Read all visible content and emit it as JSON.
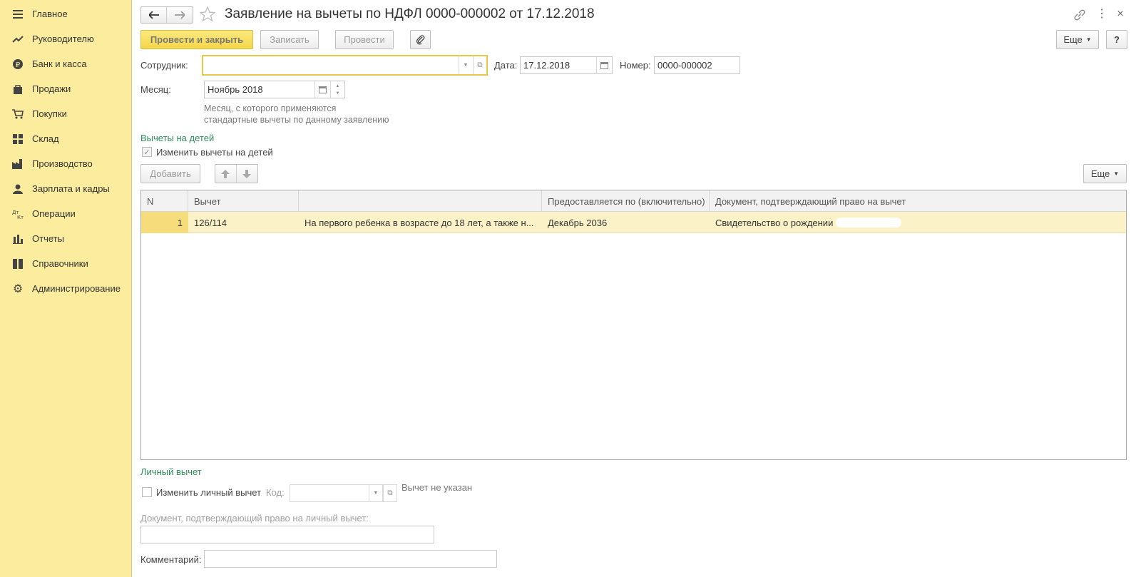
{
  "sidebar": {
    "items": [
      {
        "label": "Главное",
        "icon": "menu-icon"
      },
      {
        "label": "Руководителю",
        "icon": "trend-icon"
      },
      {
        "label": "Банк и касса",
        "icon": "ruble-icon"
      },
      {
        "label": "Продажи",
        "icon": "bag-icon"
      },
      {
        "label": "Покупки",
        "icon": "cart-icon"
      },
      {
        "label": "Склад",
        "icon": "warehouse-icon"
      },
      {
        "label": "Производство",
        "icon": "factory-icon"
      },
      {
        "label": "Зарплата и кадры",
        "icon": "person-icon"
      },
      {
        "label": "Операции",
        "icon": "dt-kt-icon"
      },
      {
        "label": "Отчеты",
        "icon": "bar-chart-icon"
      },
      {
        "label": "Справочники",
        "icon": "book-icon"
      },
      {
        "label": "Администрирование",
        "icon": "gear-icon"
      }
    ]
  },
  "header": {
    "title": "Заявление на вычеты по НДФЛ 0000-000002 от 17.12.2018"
  },
  "toolbar": {
    "post_close": "Провести и закрыть",
    "save": "Записать",
    "post": "Провести",
    "more": "Еще",
    "help": "?"
  },
  "form": {
    "employee_label": "Сотрудник:",
    "employee_value": "",
    "date_label": "Дата:",
    "date_value": "17.12.2018",
    "number_label": "Номер:",
    "number_value": "0000-000002",
    "month_label": "Месяц:",
    "month_value": "Ноябрь 2018",
    "month_hint_1": "Месяц, с которого применяются",
    "month_hint_2": "стандартные вычеты по данному заявлению"
  },
  "children": {
    "section_title": "Вычеты на детей",
    "change_checkbox_label": "Изменить вычеты на детей",
    "add_button": "Добавить",
    "more_button": "Еще",
    "columns": [
      "N",
      "Вычет",
      "",
      "Предоставляется по (включительно)",
      "Документ, подтверждающий право на вычет"
    ],
    "rows": [
      {
        "n": "1",
        "code": "126/114",
        "description": "На первого ребенка в возрасте до 18 лет, а также н...",
        "until": "Декабрь 2036",
        "document": "Свидетельство о рождении"
      }
    ]
  },
  "personal": {
    "section_title": "Личный вычет",
    "change_checkbox_label": "Изменить личный вычет",
    "code_label": "Код:",
    "code_value": "",
    "status_text": "Вычет не указан",
    "document_label": "Документ, подтверждающий право на личный вычет:",
    "document_value": "",
    "comment_label": "Комментарий:",
    "comment_value": ""
  },
  "colors": {
    "sidebar_bg": "#fbec9e",
    "accent_green": "#2e8b57",
    "primary_button": "#f4d64a",
    "selected_row": "#fcf2c8",
    "focus_border": "#e6c84a"
  }
}
